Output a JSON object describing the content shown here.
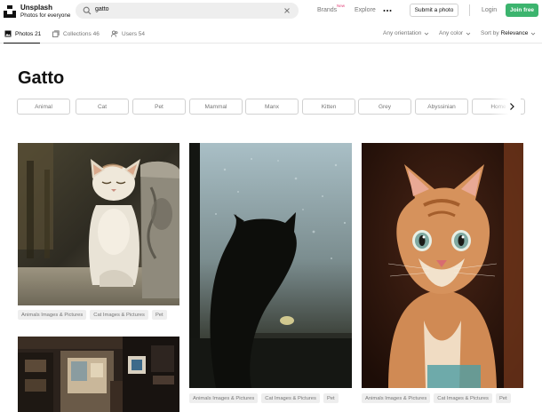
{
  "header": {
    "logo": {
      "name": "Unsplash",
      "tagline": "Photos for everyone",
      "icon": "unsplash-logo-icon"
    },
    "search": {
      "value": "gatto",
      "icon": "search-icon",
      "clear_icon": "close-icon"
    },
    "nav": {
      "brands": "Brands",
      "brands_badge": "New",
      "explore": "Explore",
      "more_icon": "more-dots-icon"
    },
    "submit_label": "Submit a photo",
    "login_label": "Login",
    "join_label": "Join free"
  },
  "filters": {
    "tabs": [
      {
        "label": "Photos",
        "count": "21",
        "icon": "photo-icon",
        "active": true
      },
      {
        "label": "Collections",
        "count": "46",
        "icon": "collections-icon",
        "active": false
      },
      {
        "label": "Users",
        "count": "54",
        "icon": "users-icon",
        "active": false
      }
    ],
    "orientation": "Any orientation",
    "color": "Any color",
    "sort_prefix": "Sort by",
    "sort_value": "Relevance"
  },
  "page": {
    "title": "Gatto"
  },
  "related": [
    "Animal",
    "Cat",
    "Pet",
    "Mammal",
    "Manx",
    "Kitten",
    "Grey",
    "Abyssinian",
    "Home"
  ],
  "photos": [
    {
      "tags": [
        "Animals Images & Pictures",
        "Cat Images & Pictures",
        "Pet"
      ]
    },
    {
      "tags": [
        "Animals Images & Pictures",
        "Cat Images & Pictures",
        "Pet"
      ]
    },
    {
      "tags": [
        "Animals Images & Pictures",
        "Cat Images & Pictures",
        "Pet"
      ]
    },
    {
      "tags": []
    }
  ],
  "colors": {
    "join": "#3cb46e",
    "new_badge": "#e2437a",
    "muted_text": "#767676"
  }
}
